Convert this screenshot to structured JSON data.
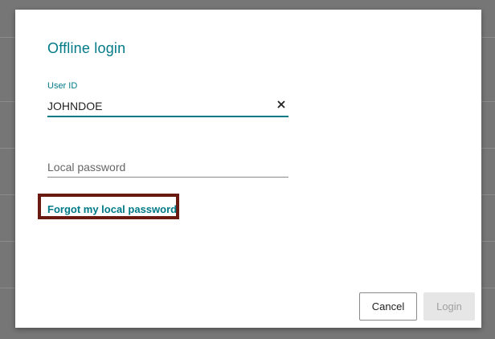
{
  "dialog": {
    "title": "Offline login",
    "user_id": {
      "label": "User ID",
      "value": "JOHNDOE"
    },
    "password": {
      "placeholder": "Local password",
      "value": ""
    },
    "forgot_link": "Forgot my local password",
    "buttons": {
      "cancel": "Cancel",
      "login": "Login"
    }
  },
  "colors": {
    "accent": "#007a87",
    "highlight_border": "#6b1a12",
    "backdrop": "#767676",
    "disabled_button": "#e6e6e6"
  },
  "icons": {
    "clear": "close-icon"
  }
}
